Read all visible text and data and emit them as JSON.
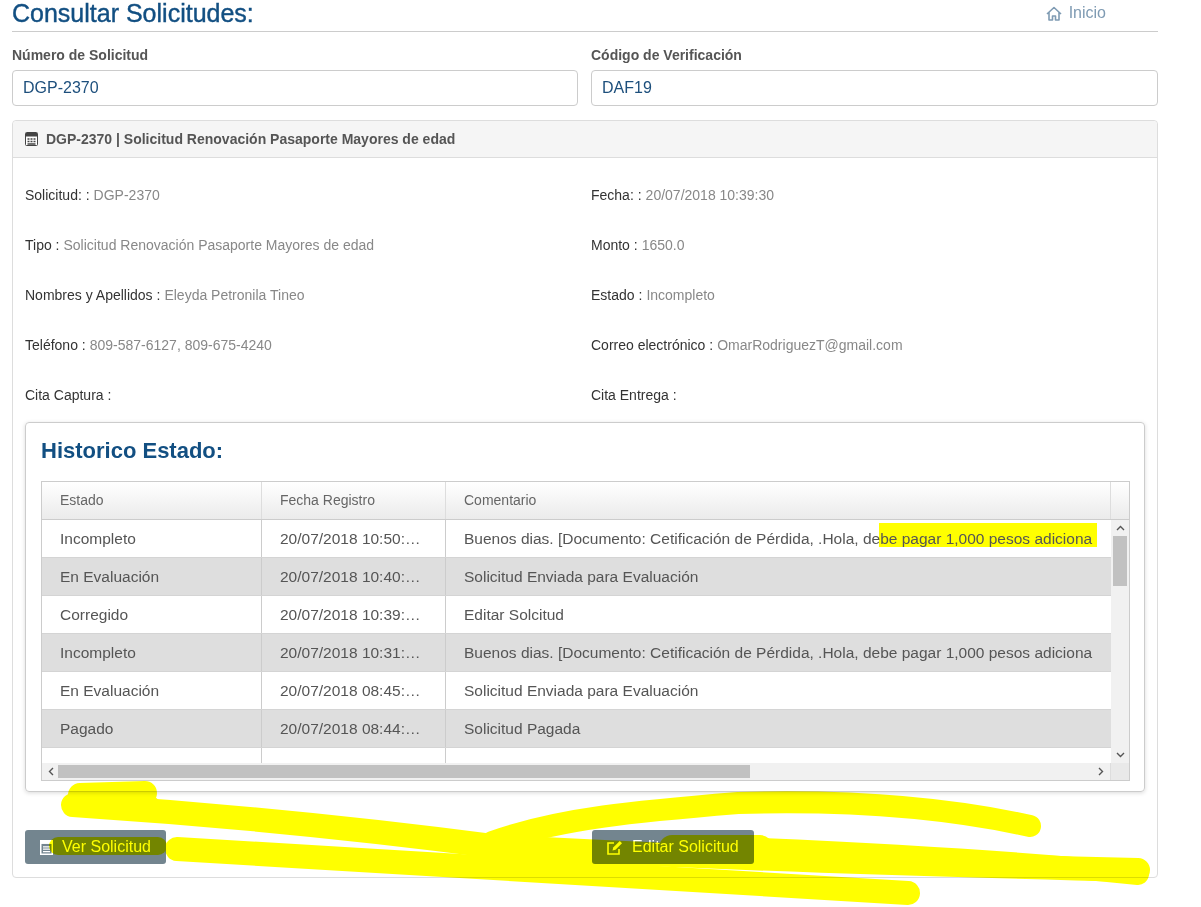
{
  "header": {
    "title": "Consultar Solicitudes:",
    "home_link": "Inicio"
  },
  "search_fields": [
    {
      "label": "Número de Solicitud",
      "value": "DGP-2370"
    },
    {
      "label": "Código de Verificación",
      "value": "DAF19"
    }
  ],
  "request_panel": {
    "title": "DGP-2370 | Solicitud Renovación Pasaporte Mayores de edad",
    "details": [
      {
        "label": "Solicitud: :",
        "value": "DGP-2370"
      },
      {
        "label": "Fecha: :",
        "value": "20/07/2018 10:39:30"
      },
      {
        "label": "Tipo :",
        "value": "Solicitud Renovación Pasaporte Mayores de edad"
      },
      {
        "label": "Monto :",
        "value": "1650.0"
      },
      {
        "label": "Nombres y Apellidos :",
        "value": "Eleyda Petronila Tineo"
      },
      {
        "label": "Estado :",
        "value": "Incompleto"
      },
      {
        "label": "Teléfono :",
        "value": "809-587-6127, 809-675-4240"
      },
      {
        "label": "Correo electrónico :",
        "value": "OmarRodriguezT@gmail.com"
      },
      {
        "label": "Cita Captura :"
      },
      {
        "label": "Cita Entrega :"
      }
    ],
    "history": {
      "title": "Historico Estado:",
      "columns": [
        "Estado",
        "Fecha Registro",
        "Comentario"
      ],
      "rows": [
        [
          "Incompleto",
          "20/07/2018 10:50:…",
          "Buenos dias. [Documento: Cetificación de Pérdida, .Hola, debe pagar 1,000 pesos adiciona"
        ],
        [
          "En Evaluación",
          "20/07/2018 10:40:…",
          "Solicitud Enviada para Evaluación"
        ],
        [
          "Corregido",
          "20/07/2018 10:39:…",
          "Editar Solcitud"
        ],
        [
          "Incompleto",
          "20/07/2018 10:31:…",
          "Buenos dias. [Documento: Cetificación de Pérdida, .Hola, debe pagar 1,000 pesos adiciona"
        ],
        [
          "En Evaluación",
          "20/07/2018 08:45:…",
          "Solicitud Enviada para Evaluación"
        ],
        [
          "Pagado",
          "20/07/2018 08:44:…",
          "Solicitud Pagada"
        ]
      ]
    },
    "buttons": [
      {
        "label": "Ver Solicitud",
        "kind": "view"
      },
      {
        "label": "Editar Solicitud",
        "kind": "edit"
      }
    ]
  }
}
